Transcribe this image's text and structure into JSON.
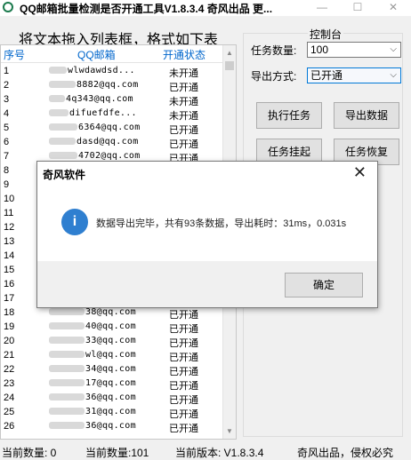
{
  "window": {
    "title": "QQ邮箱批量检测是否开通工具V1.8.3.4   奇风出品   更...",
    "minimize": "—",
    "maximize": "☐",
    "close": "✕"
  },
  "banner": "将文本拖入列表框，格式如下表",
  "list": {
    "headers": {
      "index": "序号",
      "email": "QQ邮箱",
      "status": "开通状态"
    },
    "rows": [
      {
        "index": "1",
        "email": "wlwdawdsd...",
        "status": "未开通",
        "blur": 20
      },
      {
        "index": "2",
        "email": "8882@qq.com",
        "status": "已开通",
        "blur": 30
      },
      {
        "index": "3",
        "email": "4q343@qq.com",
        "status": "未开通",
        "blur": 18
      },
      {
        "index": "4",
        "email": "difuefdfe...",
        "status": "未开通",
        "blur": 22
      },
      {
        "index": "5",
        "email": "6364@qq.com",
        "status": "已开通",
        "blur": 32
      },
      {
        "index": "6",
        "email": "dasd@qq.com",
        "status": "已开通",
        "blur": 30
      },
      {
        "index": "7",
        "email": "4702@qq.com",
        "status": "已开通",
        "blur": 32
      },
      {
        "index": "8",
        "email": "",
        "status": "",
        "blur": 0
      },
      {
        "index": "9",
        "email": "",
        "status": "",
        "blur": 0
      },
      {
        "index": "10",
        "email": "",
        "status": "",
        "blur": 0
      },
      {
        "index": "11",
        "email": "",
        "status": "",
        "blur": 0
      },
      {
        "index": "12",
        "email": "",
        "status": "",
        "blur": 0
      },
      {
        "index": "13",
        "email": "",
        "status": "",
        "blur": 0
      },
      {
        "index": "14",
        "email": "",
        "status": "",
        "blur": 0
      },
      {
        "index": "15",
        "email": "",
        "status": "",
        "blur": 0
      },
      {
        "index": "16",
        "email": "",
        "status": "",
        "blur": 0
      },
      {
        "index": "17",
        "email": "",
        "status": "",
        "blur": 0
      },
      {
        "index": "18",
        "email": "38@qq.com",
        "status": "已开通",
        "blur": 40
      },
      {
        "index": "19",
        "email": "40@qq.com",
        "status": "已开通",
        "blur": 40
      },
      {
        "index": "20",
        "email": "33@qq.com",
        "status": "已开通",
        "blur": 40
      },
      {
        "index": "21",
        "email": "wl@qq.com",
        "status": "已开通",
        "blur": 40
      },
      {
        "index": "22",
        "email": "34@qq.com",
        "status": "已开通",
        "blur": 40
      },
      {
        "index": "23",
        "email": "17@qq.com",
        "status": "已开通",
        "blur": 40
      },
      {
        "index": "24",
        "email": "36@qq.com",
        "status": "已开通",
        "blur": 40
      },
      {
        "index": "25",
        "email": "31@qq.com",
        "status": "已开通",
        "blur": 40
      },
      {
        "index": "26",
        "email": "36@qq.com",
        "status": "已开通",
        "blur": 40
      }
    ]
  },
  "control_panel": {
    "title": "控制台",
    "task_count_label": "任务数量:",
    "task_count_value": "100",
    "export_mode_label": "导出方式:",
    "export_mode_value": "已开通",
    "buttons": {
      "run": "执行任务",
      "export": "导出数据",
      "suspend": "任务挂起",
      "resume": "任务恢复"
    }
  },
  "status_bar": {
    "current_count": "当前数量: 0",
    "current_data": "当前数量:101",
    "current_version": "当前版本: V1.8.3.4",
    "copyright": "奇风出品，侵权必究"
  },
  "dialog": {
    "title": "奇风软件",
    "icon_glyph": "i",
    "message": "数据导出完毕，共有93条数据，导出耗时：31ms，0.031s",
    "ok": "确定"
  },
  "colors": {
    "header_text": "#0066cc",
    "info_icon": "#2f7fd0",
    "select_focus": "#0078d7"
  }
}
